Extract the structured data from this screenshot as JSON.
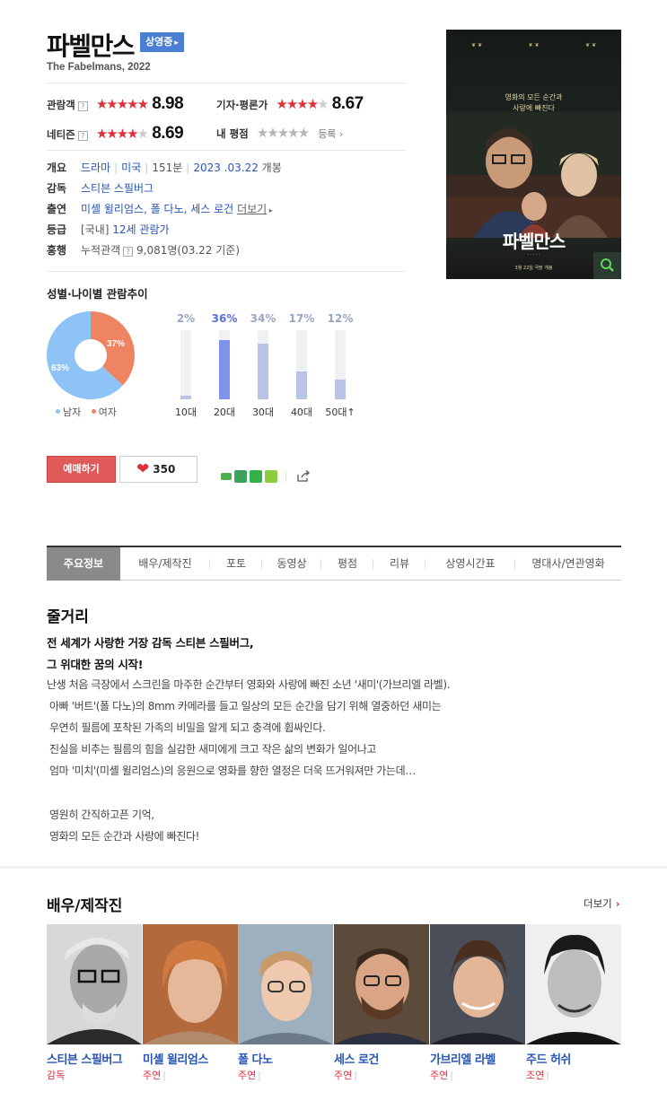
{
  "movie": {
    "title": "파벨만스",
    "status_badge": "상영중",
    "subtitle": "The Fabelmans, 2022"
  },
  "ratings": {
    "audience": {
      "label": "관람객",
      "score": "8.98",
      "stars": 4.5
    },
    "critic": {
      "label": "기자·평론가",
      "score": "8.67",
      "stars": 4.5
    },
    "netizen": {
      "label": "네티즌",
      "score": "8.69",
      "stars": 4.5
    },
    "mine": {
      "label": "내 평점",
      "register": "등록"
    }
  },
  "info": {
    "overview_label": "개요",
    "genre": "드라마",
    "country": "미국",
    "runtime": "151분",
    "release_date": "2023 .03.22",
    "release_suffix": "개봉",
    "director_label": "감독",
    "director": "스티븐 스필버그",
    "cast_label": "출연",
    "cast": "미셸 윌리엄스, 폴 다노, 세스 로건",
    "more": "더보기",
    "grade_label": "등급",
    "grade_prefix": "[국내]",
    "grade": "12세 관람가",
    "boxoffice_label": "흥행",
    "boxoffice_key": "누적관객",
    "boxoffice_value": "9,081명(03.22 기준)"
  },
  "poster": {
    "tagline_1": "영화의 모든 순간과",
    "tagline_2": "사랑에 빠진다",
    "title": "파벨만스",
    "date_line": "3월 22일 극장 개봉"
  },
  "demographics": {
    "title": "성별·나이별 관람추이",
    "male_label": "남자",
    "female_label": "여자",
    "male_pct": "63%",
    "female_pct": "37%",
    "male_color": "#8ec3f5",
    "female_color": "#ef8463",
    "ages": [
      {
        "label": "10대",
        "pct": "2%",
        "value": 2
      },
      {
        "label": "20대",
        "pct": "36%",
        "value": 36
      },
      {
        "label": "30대",
        "pct": "34%",
        "value": 34
      },
      {
        "label": "40대",
        "pct": "17%",
        "value": 17
      },
      {
        "label": "50대↑",
        "pct": "12%",
        "value": 12
      }
    ]
  },
  "actions": {
    "book": "예매하기",
    "like_count": "350"
  },
  "tabs": [
    "주요정보",
    "배우/제작진",
    "포토",
    "동영상",
    "평점",
    "리뷰",
    "상영시간표",
    "명대사/연관영화"
  ],
  "synopsis": {
    "heading": "줄거리",
    "bold_1": "전 세계가 사랑한 거장 감독 스티븐 스필버그,",
    "bold_2": "그 위대한 꿈의 시작!",
    "lines": [
      "난생 처음 극장에서 스크린을 마주한 순간부터 영화와 사랑에 빠진 소년 '새미'(가브리엘 라벨).",
      "아빠 '버트'(폴 다노)의 8mm 카메라를 들고 일상의 모든 순간을 담기 위해 열중하던 새미는",
      "우연히 필름에 포착된 가족의 비밀을 알게 되고 충격에 휩싸인다.",
      "진실을 비추는 필름의 힘을 실감한 새미에게 크고 작은 삶의 변화가 일어나고",
      "엄마 '미치'(미셸 윌리엄스)의 응원으로 영화를 향한 열정은 더욱 뜨거워져만 가는데…",
      "영원히 간직하고픈 기억,",
      "영화의 모든 순간과 사랑에 빠진다!"
    ]
  },
  "cast_section": {
    "heading": "배우/제작진",
    "more": "더보기",
    "people": [
      {
        "name": "스티븐 스필버그",
        "role": "감독"
      },
      {
        "name": "미셸 윌리엄스",
        "role": "주연"
      },
      {
        "name": "폴 다노",
        "role": "주연"
      },
      {
        "name": "세스 로건",
        "role": "주연"
      },
      {
        "name": "가브리엘 라벨",
        "role": "주연"
      },
      {
        "name": "주드 허쉬",
        "role": "조연"
      }
    ]
  }
}
